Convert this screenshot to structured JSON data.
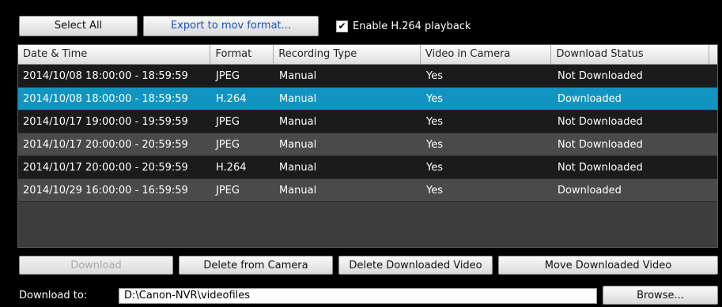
{
  "toolbar": {
    "select_all_label": "Select All",
    "export_label": "Export to mov format...",
    "enable_h264_label": "Enable H.264 playback",
    "enable_h264_checked": true
  },
  "table": {
    "columns": [
      "Date & Time",
      "Format",
      "Recording Type",
      "Video in Camera",
      "Download Status"
    ],
    "rows": [
      {
        "datetime": "2014/10/08 18:00:00 - 18:59:59",
        "format": "JPEG",
        "type": "Manual",
        "in_camera": "Yes",
        "status": "Not Downloaded"
      },
      {
        "datetime": "2014/10/08 18:00:00 - 18:59:59",
        "format": "H.264",
        "type": "Manual",
        "in_camera": "Yes",
        "status": "Downloaded"
      },
      {
        "datetime": "2014/10/17 19:00:00 - 19:59:59",
        "format": "JPEG",
        "type": "Manual",
        "in_camera": "Yes",
        "status": "Not Downloaded"
      },
      {
        "datetime": "2014/10/17 20:00:00 - 20:59:59",
        "format": "JPEG",
        "type": "Manual",
        "in_camera": "Yes",
        "status": "Not Downloaded"
      },
      {
        "datetime": "2014/10/17 20:00:00 - 20:59:59",
        "format": "H.264",
        "type": "Manual",
        "in_camera": "Yes",
        "status": "Not Downloaded"
      },
      {
        "datetime": "2014/10/29 16:00:00 - 16:59:59",
        "format": "JPEG",
        "type": "Manual",
        "in_camera": "Yes",
        "status": "Downloaded"
      }
    ],
    "selected_index": 1
  },
  "actions": {
    "download_label": "Download",
    "delete_camera_label": "Delete from Camera",
    "delete_downloaded_label": "Delete Downloaded Video",
    "move_downloaded_label": "Move Downloaded Video"
  },
  "download_to": {
    "label": "Download to:",
    "path": "D:\\Canon-NVR\\videofiles",
    "browse_label": "Browse..."
  },
  "colors": {
    "selected_row": "#1195c0",
    "background": "#000000"
  }
}
